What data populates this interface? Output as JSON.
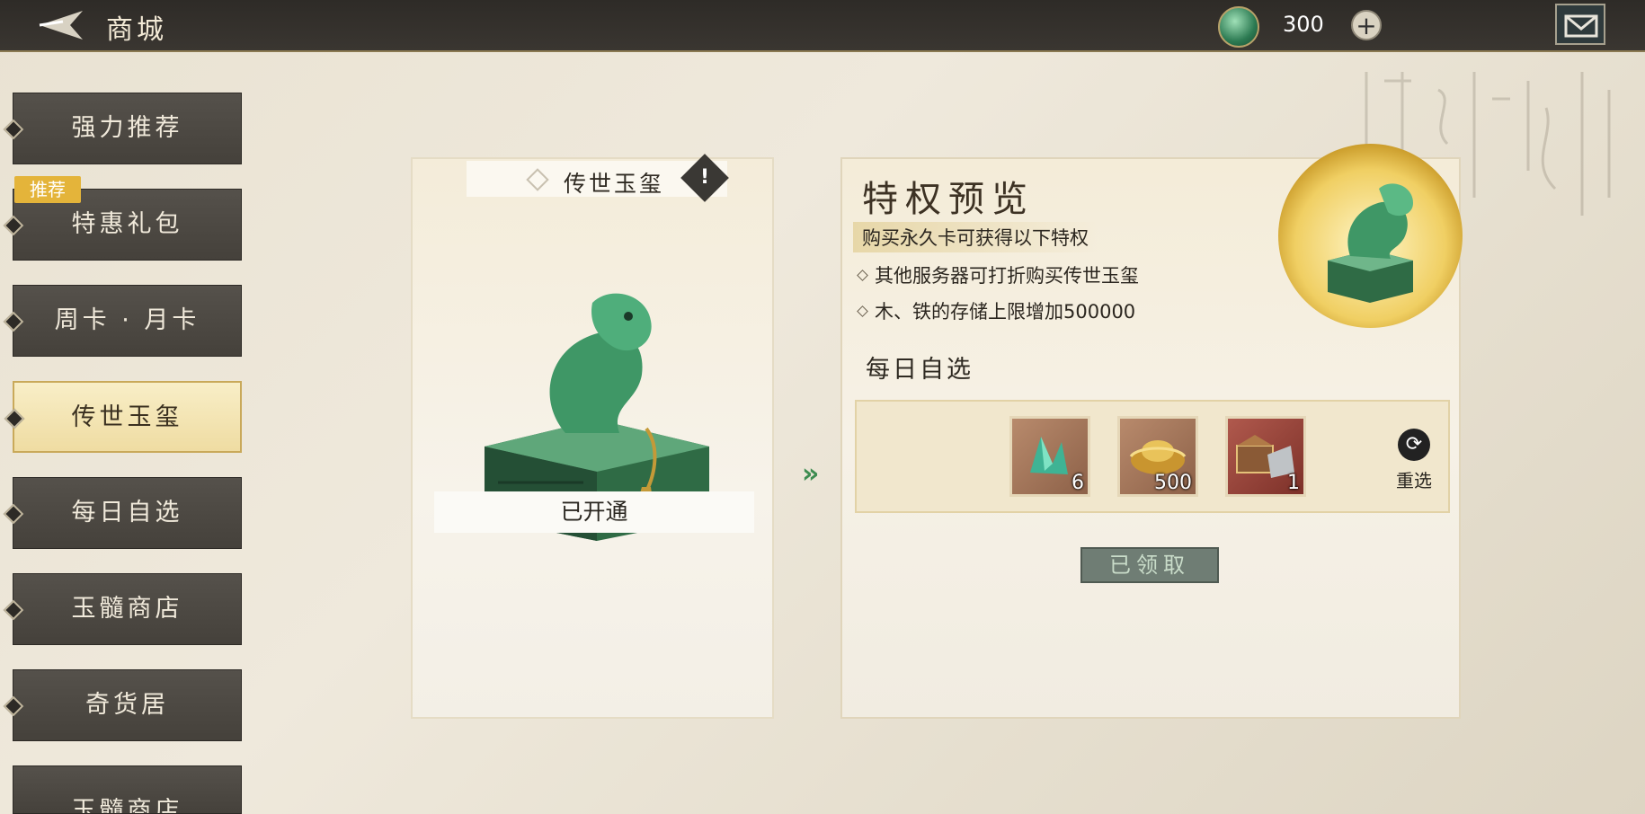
{
  "header": {
    "title": "商城",
    "currency_value": "300",
    "plus": "+"
  },
  "sidebar": {
    "items": [
      {
        "label": "强力推荐"
      },
      {
        "label": "特惠礼包"
      },
      {
        "label": "周卡 · 月卡"
      },
      {
        "label": "传世玉玺"
      },
      {
        "label": "每日自选"
      },
      {
        "label": "玉髓商店"
      },
      {
        "label": "奇货居"
      },
      {
        "label": "玉髓商店"
      }
    ],
    "badge": "推荐",
    "active_index": 3
  },
  "card": {
    "title": "传世玉玺",
    "info": "!",
    "status": "已开通"
  },
  "panel": {
    "title": "特权预览",
    "intro": "购买永久卡可获得以下特权",
    "privileges": [
      "其他服务器可打折购买传世玉玺",
      "木、铁的存储上限增加500000"
    ],
    "daily_title": "每日自选",
    "rewards": [
      {
        "icon": "jade-crystal-icon",
        "count": "6"
      },
      {
        "icon": "gold-ingot-icon",
        "count": "500"
      },
      {
        "icon": "treasure-chest-icon",
        "count": "1"
      }
    ],
    "reroll_label": "重选",
    "claimed_label": "已领取"
  },
  "colors": {
    "accent": "#e4b43a",
    "jade": "#2c7a52",
    "dark_bar": "#3a3631"
  }
}
